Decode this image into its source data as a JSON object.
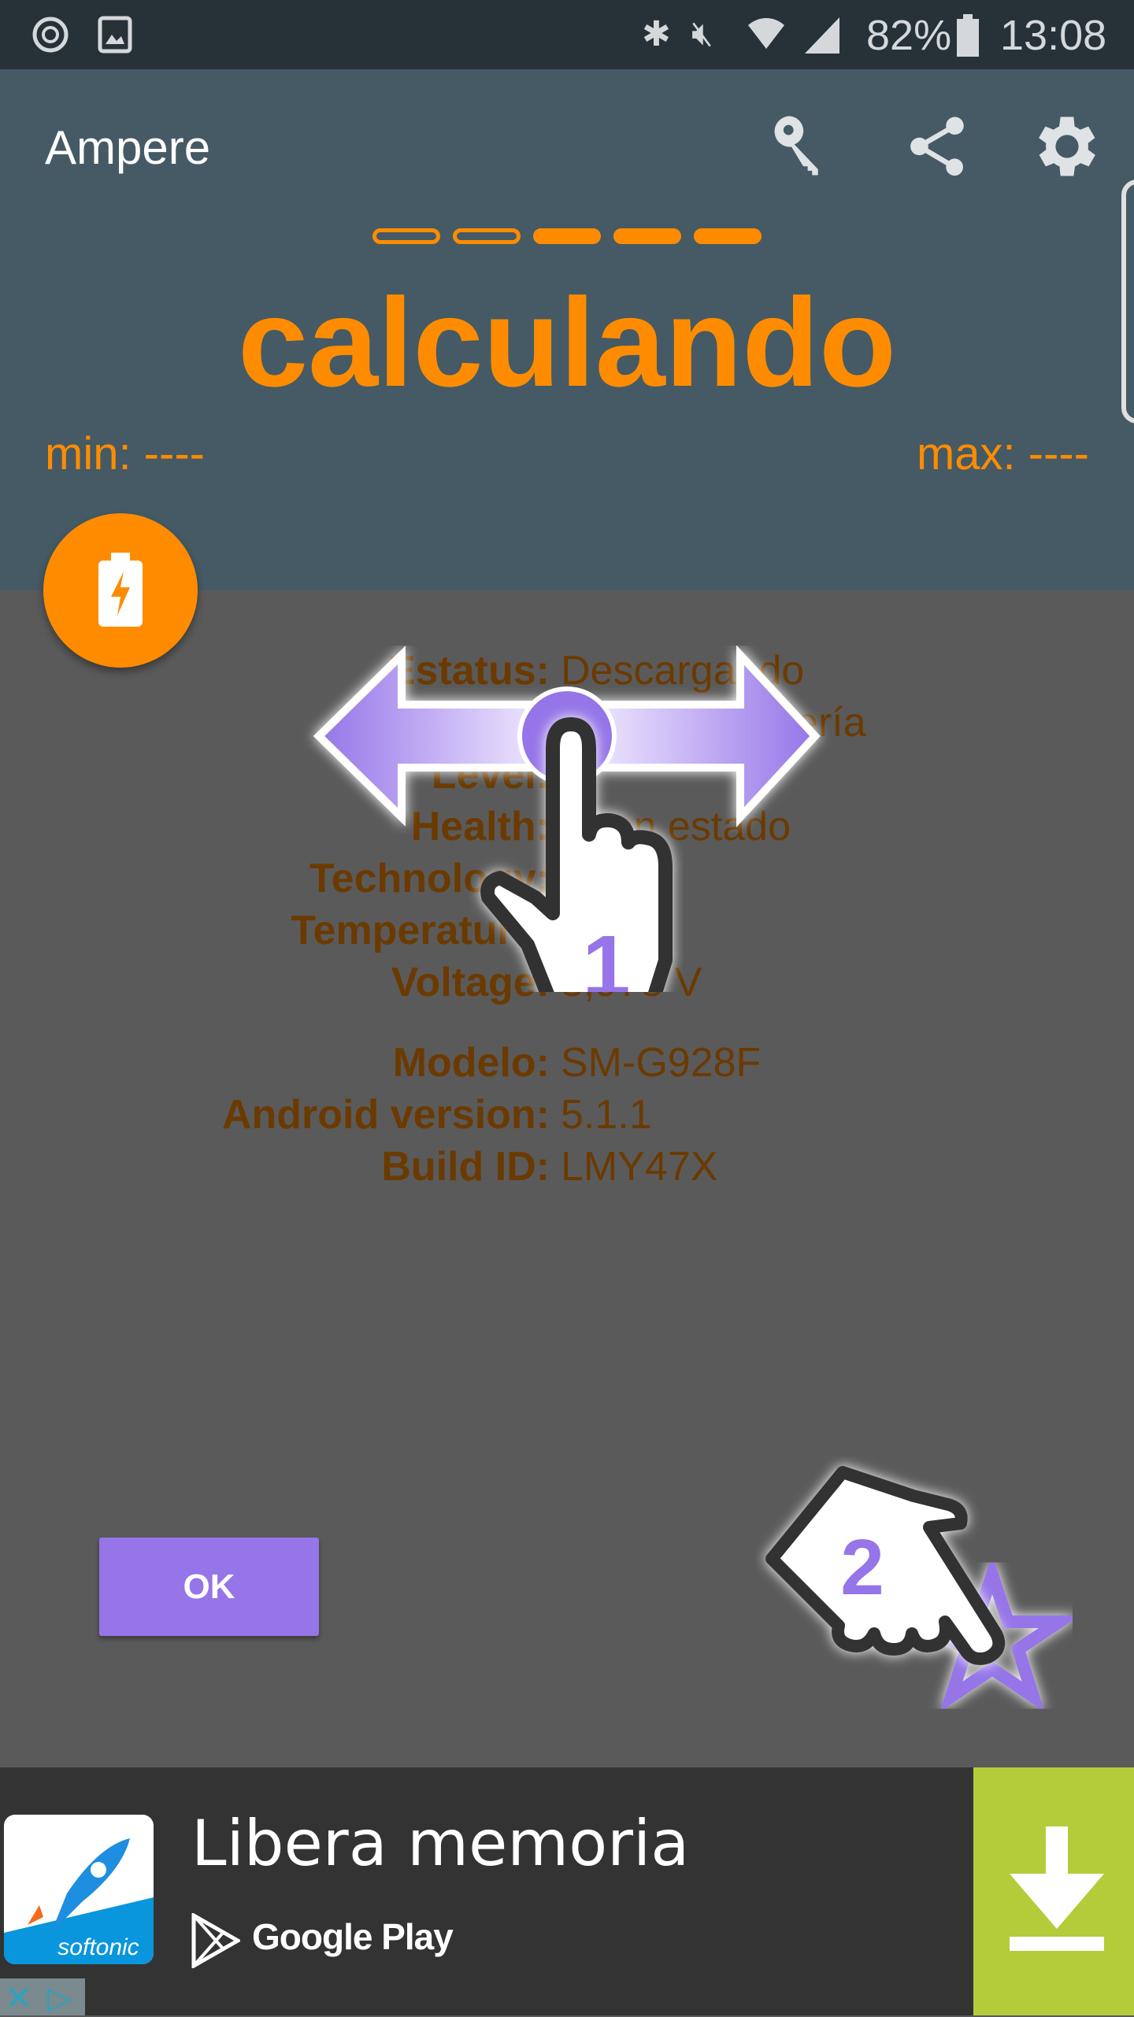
{
  "status_bar": {
    "battery": "82%",
    "time": "13:08"
  },
  "app_bar": {
    "title": "Ampere",
    "icons": [
      "key-icon",
      "share-icon",
      "gear-icon"
    ]
  },
  "meter": {
    "segments_filled": 3,
    "segments_total": 5,
    "reading": "calculando",
    "min": "min: ----",
    "max": "max: ----"
  },
  "colors": {
    "accent": "#FF8C00",
    "appbar": "#455A64",
    "statusbar": "#263238",
    "tutorial": "#9575E8",
    "ad_button": "#B5CC3A"
  },
  "info": [
    {
      "label": "Estatus:",
      "value": "Descargando"
    },
    {
      "label": "",
      "value": "Batería"
    },
    {
      "label": "Level:",
      "value": ""
    },
    {
      "label": "Health:",
      "value": "Buen estado"
    },
    {
      "label": "Technology:",
      "value": ""
    },
    {
      "label": "Temperature:",
      "value": ""
    },
    {
      "label": "Voltage:",
      "value": "3,978 V"
    }
  ],
  "device": [
    {
      "label": "Modelo:",
      "value": "SM-G928F"
    },
    {
      "label": "Android version:",
      "value": "5.1.1"
    },
    {
      "label": "Build ID:",
      "value": "LMY47X"
    }
  ],
  "tutorial": {
    "step1": "1",
    "step2": "2",
    "ok_label": "OK"
  },
  "ad": {
    "title": "Libera memoria",
    "store": "Google Play",
    "brand": "softonic"
  }
}
